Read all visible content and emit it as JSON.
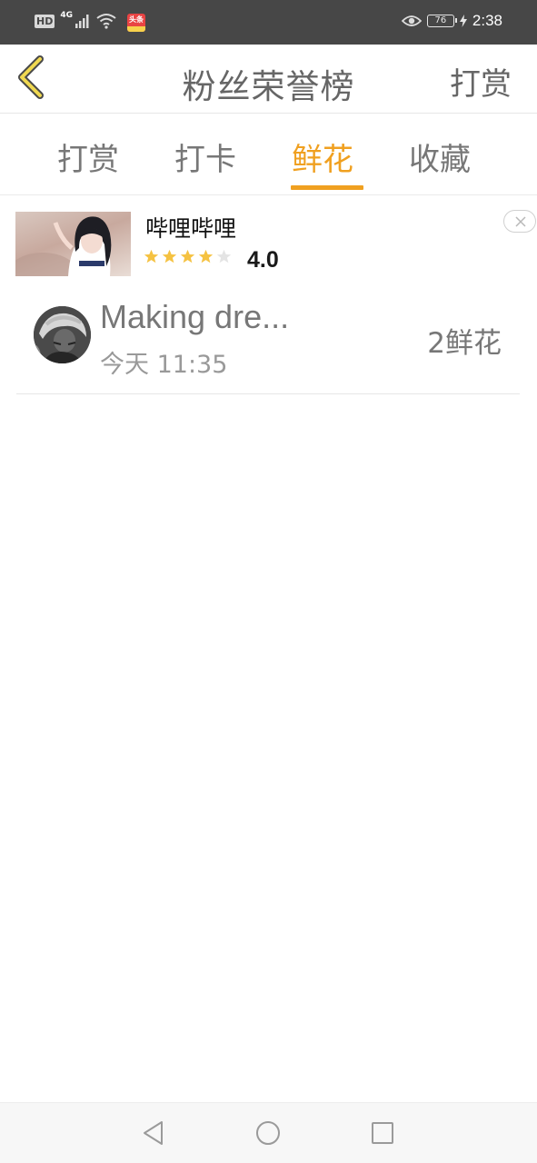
{
  "status_bar": {
    "hd": "HD",
    "network": "4G",
    "battery": "76",
    "time": "2:38",
    "notification_app": "头条",
    "text_color": "#ffffff",
    "background": "#474747",
    "icons": [
      "hd-badge-icon",
      "signal-icon",
      "wifi-icon",
      "app-notification-icon",
      "eye-comfort-icon",
      "battery-icon",
      "charging-bolt-icon"
    ]
  },
  "header": {
    "title": "粉丝荣誉榜",
    "right_action": "打赏",
    "back_icon": "chevron-left-icon",
    "back_icon_color": "#f0c830"
  },
  "tabs": {
    "items": [
      {
        "label": "打赏",
        "active": false
      },
      {
        "label": "打卡",
        "active": false
      },
      {
        "label": "鲜花",
        "active": true
      },
      {
        "label": "收藏",
        "active": false
      }
    ],
    "active_color": "#f0a020",
    "inactive_color": "#777777"
  },
  "ad": {
    "thumb_caption": "哔哩哔哩",
    "title": "哔哩哔哩",
    "rating": "4.0",
    "stars": 4,
    "max_stars": 5,
    "star_color": "#f5c242",
    "close_icon": "close-icon"
  },
  "list": {
    "items": [
      {
        "name": "Making dre...",
        "time": "今天 11:35",
        "value": "2鲜花",
        "avatar_icon": "user-avatar"
      }
    ]
  },
  "nav_bar": {
    "icons": [
      "back-triangle-icon",
      "home-circle-icon",
      "recents-square-icon"
    ]
  }
}
